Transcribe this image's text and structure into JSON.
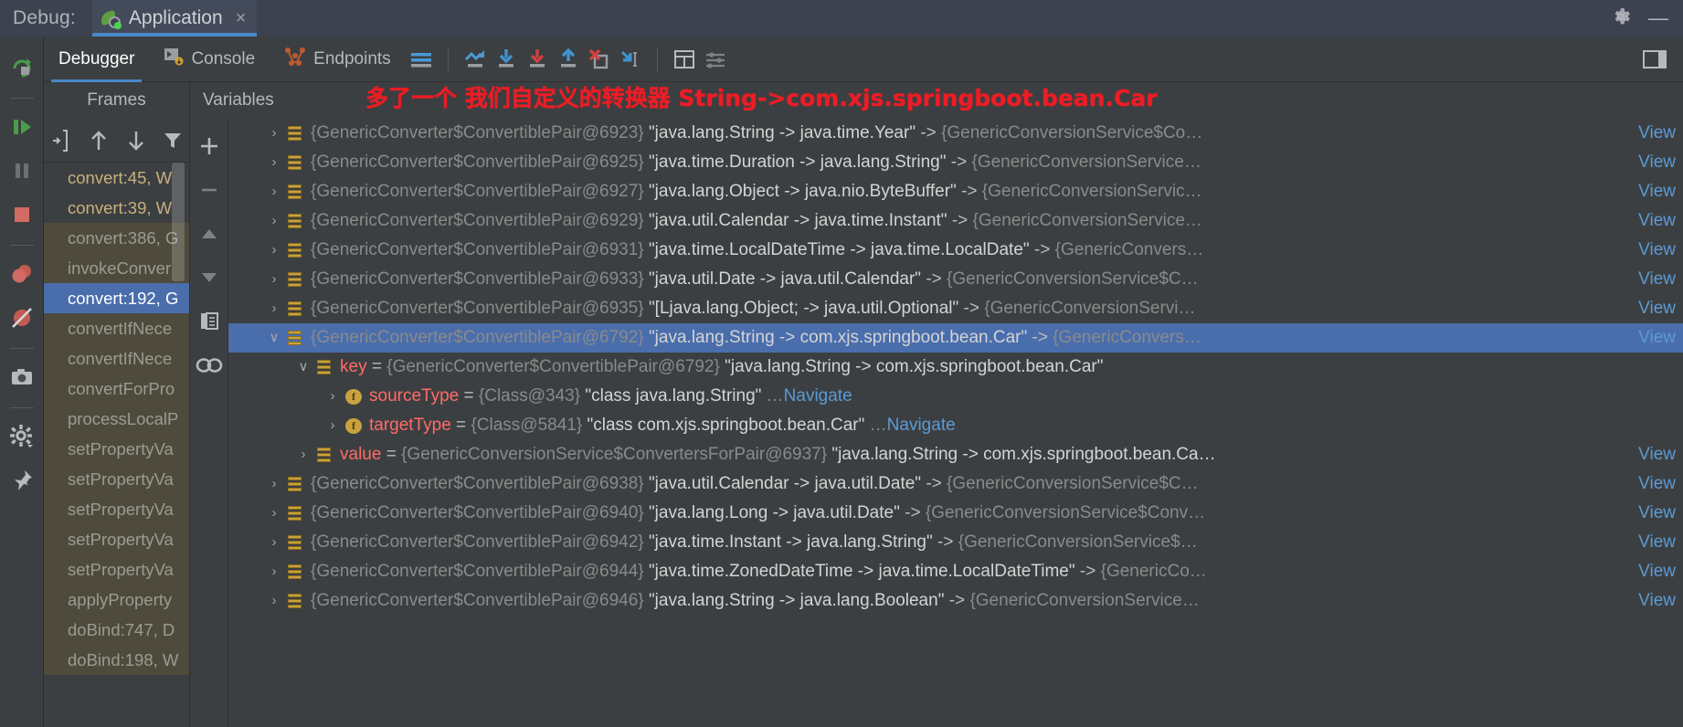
{
  "titlebar": {
    "debug_label": "Debug:",
    "tab_title": "Application",
    "tab_icon": "spring-boot-icon",
    "close_icon": "×",
    "settings_icon": "gear-icon",
    "minimize_icon": "—"
  },
  "left_rail": {
    "buttons": [
      {
        "name": "rerun-button",
        "icon": "rerun-icon"
      },
      {
        "name": "resume-program-button",
        "icon": "resume-icon"
      },
      {
        "name": "pause-program-button",
        "icon": "pause-icon"
      },
      {
        "name": "stop-button",
        "icon": "stop-icon"
      },
      {
        "name": "view-breakpoints-button",
        "icon": "breakpoints-icon"
      },
      {
        "name": "mute-breakpoints-button",
        "icon": "mute-breakpoints-icon"
      },
      {
        "name": "screenshot-button",
        "icon": "camera-icon"
      },
      {
        "name": "settings-button",
        "icon": "gear-icon"
      },
      {
        "name": "pin-tab-button",
        "icon": "pin-icon"
      }
    ]
  },
  "tabstrip": {
    "tabs": [
      {
        "label": "Debugger",
        "icon": "debugger-icon",
        "active": true
      },
      {
        "label": "Console",
        "icon": "console-icon",
        "active": false
      },
      {
        "label": "Endpoints",
        "icon": "endpoints-icon",
        "active": false
      }
    ],
    "tools": [
      {
        "name": "layout-settings-icon",
        "title": "Layout Settings"
      },
      {
        "name": "show-execution-point-icon",
        "title": "Show Execution Point"
      },
      {
        "name": "step-over-icon",
        "title": "Step Over"
      },
      {
        "name": "step-into-icon",
        "title": "Step Into"
      },
      {
        "name": "step-out-icon",
        "title": "Step Out"
      },
      {
        "name": "drop-frame-icon",
        "title": "Drop Frame"
      },
      {
        "name": "run-to-cursor-icon",
        "title": "Run to Cursor"
      },
      {
        "name": "evaluate-expression-icon",
        "title": "Evaluate Expression"
      },
      {
        "name": "settings-sliders-icon",
        "title": "Settings"
      }
    ],
    "right_icon": "restore-layout-icon"
  },
  "frames_panel": {
    "header": "Frames",
    "toolbar": [
      {
        "name": "thread-selector-icon",
        "glyph": "→]"
      },
      {
        "name": "move-up-icon",
        "glyph": "↑"
      },
      {
        "name": "move-down-icon",
        "glyph": "↓"
      },
      {
        "name": "filter-icon",
        "glyph": "▼"
      }
    ],
    "frames": [
      {
        "label": "convert:45, W",
        "style": "my"
      },
      {
        "label": "convert:39, W",
        "style": "my"
      },
      {
        "label": "convert:386, G",
        "style": "lib"
      },
      {
        "label": "invokeConver",
        "style": "lib"
      },
      {
        "label": "convert:192, G",
        "style": "sel"
      },
      {
        "label": "convertIfNece",
        "style": "lib"
      },
      {
        "label": "convertIfNece",
        "style": "lib"
      },
      {
        "label": "convertForPro",
        "style": "lib"
      },
      {
        "label": "processLocalP",
        "style": "lib"
      },
      {
        "label": "setPropertyVa",
        "style": "lib"
      },
      {
        "label": "setPropertyVa",
        "style": "lib"
      },
      {
        "label": "setPropertyVa",
        "style": "lib"
      },
      {
        "label": "setPropertyVa",
        "style": "lib"
      },
      {
        "label": "setPropertyVa",
        "style": "lib"
      },
      {
        "label": "applyProperty",
        "style": "lib"
      },
      {
        "label": "doBind:747, D",
        "style": "lib"
      },
      {
        "label": "doBind:198, W",
        "style": "lib"
      }
    ]
  },
  "variables_panel": {
    "header": "Variables",
    "toolbar": [
      {
        "name": "add-watch-icon",
        "glyph": "+"
      },
      {
        "name": "remove-watch-icon",
        "glyph": "−"
      },
      {
        "name": "move-watch-up-icon",
        "glyph": "▲"
      },
      {
        "name": "move-watch-down-icon",
        "glyph": "▼"
      },
      {
        "name": "copy-value-icon",
        "glyph": "❐"
      },
      {
        "name": "inspect-icon",
        "glyph": "∞"
      }
    ],
    "view_link_label": "View",
    "navigate_link_label": "Navigate",
    "ellipsis": "…",
    "rows": [
      {
        "indent": 0,
        "arrow": "closed",
        "icon": "list",
        "ref": "{GenericConverter$ConvertiblePair@6923}",
        "string": "\"java.lang.String -> java.time.Year\"",
        "arrow_text": "->",
        "tail_ref": "{GenericConversionService$Co…",
        "link": "View",
        "selected": false
      },
      {
        "indent": 0,
        "arrow": "closed",
        "icon": "list",
        "ref": "{GenericConverter$ConvertiblePair@6925}",
        "string": "\"java.time.Duration -> java.lang.String\"",
        "arrow_text": "->",
        "tail_ref": "{GenericConversionService…",
        "link": "View",
        "selected": false
      },
      {
        "indent": 0,
        "arrow": "closed",
        "icon": "list",
        "ref": "{GenericConverter$ConvertiblePair@6927}",
        "string": "\"java.lang.Object -> java.nio.ByteBuffer\"",
        "arrow_text": "->",
        "tail_ref": "{GenericConversionServic…",
        "link": "View",
        "selected": false
      },
      {
        "indent": 0,
        "arrow": "closed",
        "icon": "list",
        "ref": "{GenericConverter$ConvertiblePair@6929}",
        "string": "\"java.util.Calendar -> java.time.Instant\"",
        "arrow_text": "->",
        "tail_ref": "{GenericConversionService…",
        "link": "View",
        "selected": false
      },
      {
        "indent": 0,
        "arrow": "closed",
        "icon": "list",
        "ref": "{GenericConverter$ConvertiblePair@6931}",
        "string": "\"java.time.LocalDateTime -> java.time.LocalDate\"",
        "arrow_text": "->",
        "tail_ref": "{GenericConvers…",
        "link": "View",
        "selected": false
      },
      {
        "indent": 0,
        "arrow": "closed",
        "icon": "list",
        "ref": "{GenericConverter$ConvertiblePair@6933}",
        "string": "\"java.util.Date -> java.util.Calendar\"",
        "arrow_text": "->",
        "tail_ref": "{GenericConversionService$C…",
        "link": "View",
        "selected": false
      },
      {
        "indent": 0,
        "arrow": "closed",
        "icon": "list",
        "ref": "{GenericConverter$ConvertiblePair@6935}",
        "string": "\"[Ljava.lang.Object; -> java.util.Optional\"",
        "arrow_text": "->",
        "tail_ref": "{GenericConversionServi…",
        "link": "View",
        "selected": false
      },
      {
        "indent": 0,
        "arrow": "open",
        "icon": "list",
        "ref": "{GenericConverter$ConvertiblePair@6792}",
        "string": "\"java.lang.String -> com.xjs.springboot.bean.Car\"",
        "arrow_text": "->",
        "tail_ref": "{GenericConvers…",
        "link": "View",
        "selected": true
      },
      {
        "indent": 1,
        "arrow": "open",
        "icon": "list",
        "name": "key",
        "eq": "=",
        "ref": "{GenericConverter$ConvertiblePair@6792}",
        "string": "\"java.lang.String -> com.xjs.springboot.bean.Car\"",
        "selected": false
      },
      {
        "indent": 2,
        "arrow": "closed",
        "icon": "field",
        "name": "sourceType",
        "eq": "=",
        "ref": "{Class@343}",
        "string": "\"class java.lang.String\"",
        "ellipsis_tail": "…",
        "link2": "Navigate",
        "selected": false
      },
      {
        "indent": 2,
        "arrow": "closed",
        "icon": "field",
        "name": "targetType",
        "eq": "=",
        "ref": "{Class@5841}",
        "string": "\"class com.xjs.springboot.bean.Car\"",
        "ellipsis_tail": "…",
        "link2": "Navigate",
        "selected": false
      },
      {
        "indent": 1,
        "arrow": "closed",
        "icon": "list",
        "name": "value",
        "eq": "=",
        "ref": "{GenericConversionService$ConvertersForPair@6937}",
        "string": "\"java.lang.String -> com.xjs.springboot.bean.Ca…",
        "link": "View",
        "selected": false
      },
      {
        "indent": 0,
        "arrow": "closed",
        "icon": "list",
        "ref": "{GenericConverter$ConvertiblePair@6938}",
        "string": "\"java.util.Calendar -> java.util.Date\"",
        "arrow_text": "->",
        "tail_ref": "{GenericConversionService$C…",
        "link": "View",
        "selected": false
      },
      {
        "indent": 0,
        "arrow": "closed",
        "icon": "list",
        "ref": "{GenericConverter$ConvertiblePair@6940}",
        "string": "\"java.lang.Long -> java.util.Date\"",
        "arrow_text": "->",
        "tail_ref": "{GenericConversionService$Conv…",
        "link": "View",
        "selected": false
      },
      {
        "indent": 0,
        "arrow": "closed",
        "icon": "list",
        "ref": "{GenericConverter$ConvertiblePair@6942}",
        "string": "\"java.time.Instant -> java.lang.String\"",
        "arrow_text": "->",
        "tail_ref": "{GenericConversionService$…",
        "link": "View",
        "selected": false
      },
      {
        "indent": 0,
        "arrow": "closed",
        "icon": "list",
        "ref": "{GenericConverter$ConvertiblePair@6944}",
        "string": "\"java.time.ZonedDateTime -> java.time.LocalDateTime\"",
        "arrow_text": "->",
        "tail_ref": "{GenericCo…",
        "link": "View",
        "selected": false
      },
      {
        "indent": 0,
        "arrow": "closed",
        "icon": "list",
        "ref": "{GenericConverter$ConvertiblePair@6946}",
        "string": "\"java.lang.String -> java.lang.Boolean\"",
        "arrow_text": "->",
        "tail_ref": "{GenericConversionService…",
        "link": "View",
        "selected": false
      }
    ]
  },
  "annotation": {
    "text": "多了一个 我们自定义的转换器 String->com.xjs.springboot.bean.Car",
    "color": "#ee1c25"
  },
  "colors": {
    "accent_blue": "#4a88c7",
    "selection_blue": "#4a6eac",
    "panel_bg": "#3c3f41",
    "titlebar_bg": "#3c4250",
    "lib_frame_bg": "#4f4b3c",
    "gold_icon": "#c9a23f",
    "red_name": "#ff6b68",
    "link_blue": "#5b9ad6"
  }
}
